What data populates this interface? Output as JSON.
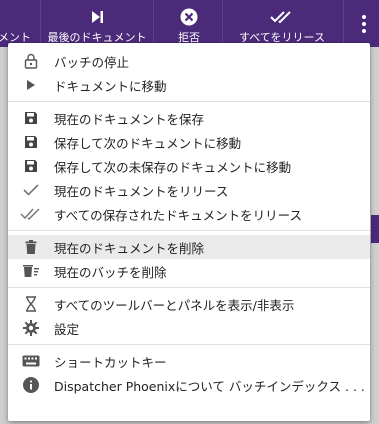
{
  "toolbar": {
    "items": [
      {
        "label": "メント"
      },
      {
        "label": "最後のドキュメント"
      },
      {
        "label": "拒否"
      },
      {
        "label": "すべてをリリース"
      }
    ]
  },
  "menu": {
    "pause_batch": "バッチの停止",
    "go_to_document": "ドキュメントに移動",
    "save_document": "現在のドキュメントを保存",
    "save_and_next": "保存して次のドキュメントに移動",
    "save_and_next_unsaved": "保存して次の未保存のドキュメントに移動",
    "release_document": "現在のドキュメントをリリース",
    "release_all_saved": "すべての保存されたドキュメントをリリース",
    "delete_document": "現在のドキュメントを削除",
    "delete_batch": "現在のバッチを削除",
    "toggle_toolbars": "すべてのツールバーとパネルを表示/非表示",
    "settings": "設定",
    "shortcuts": "ショートカットキー",
    "about": "Dispatcher Phoenixについて バッチインデックス . . ."
  },
  "colors": {
    "toolbar": "#4b2a7a",
    "menu_bg": "#ffffff",
    "highlight": "#eaeaea"
  }
}
